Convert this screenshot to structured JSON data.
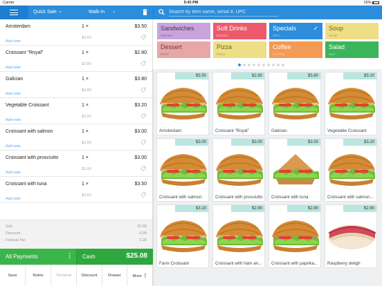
{
  "status_bar": {
    "carrier": "Carrier",
    "time": "5:43 PM",
    "battery": "15%"
  },
  "header": {
    "order_type": "Quick Sale",
    "customer": "Walk-In"
  },
  "search": {
    "placeholder": "Search by item name, serial #, UPC"
  },
  "order_items": [
    {
      "name": "Amsterdam",
      "qty": "1 ×",
      "price": "$3.50",
      "unit": "$3.50",
      "note": "Add note"
    },
    {
      "name": "Croissant \"Royal\"",
      "qty": "1 ×",
      "price": "$2.80",
      "unit": "$2.80",
      "note": "Add note"
    },
    {
      "name": "Galician",
      "qty": "1 ×",
      "price": "$3.80",
      "unit": "$3.80",
      "note": "Add note"
    },
    {
      "name": "Vegetable Croissant",
      "qty": "1 ×",
      "price": "$3.20",
      "unit": "$3.20",
      "note": "Add note"
    },
    {
      "name": "Croissant with salmon",
      "qty": "1 ×",
      "price": "$3.00",
      "unit": "$3.00",
      "note": "Add note"
    },
    {
      "name": "Croissant with prosciutto",
      "qty": "1 ×",
      "price": "$3.00",
      "unit": "$3.00",
      "note": "Add note"
    },
    {
      "name": "Croissant with tuna",
      "qty": "1 ×",
      "price": "$3.50",
      "unit": "$3.50",
      "note": "Add note"
    }
  ],
  "totals": {
    "sub_label": "Sub",
    "sub_value": "22.80",
    "discount_label": "Discount",
    "discount_value": "0.00",
    "tax_label": "Federal Tax",
    "tax_value": "2.28"
  },
  "payment": {
    "all_label": "All Payments",
    "cash_label": "Cash",
    "cash_amount": "$25.08"
  },
  "tabs": [
    "Save",
    "Notes",
    "Terminal",
    "Discount",
    "Drawer",
    "More"
  ],
  "categories": [
    {
      "name": "Sandwiches",
      "sub": "SNDWS",
      "bg": "#c9a4dc",
      "fg": "#4a3657"
    },
    {
      "name": "Soft Drinks",
      "sub": "DRINKS",
      "bg": "#ec5b6c",
      "fg": "#ffffff"
    },
    {
      "name": "Specials",
      "sub": "SPCL",
      "bg": "#2b8ddb",
      "fg": "#ffffff",
      "selected": true
    },
    {
      "name": "Soup",
      "sub": "SOUP",
      "bg": "#eedf86",
      "fg": "#6b6232"
    },
    {
      "name": "Dessert",
      "sub": "DSRT",
      "bg": "#e8a7a7",
      "fg": "#6b3c3c"
    },
    {
      "name": "Pizza",
      "sub": "PIZZA",
      "bg": "#eedf86",
      "fg": "#6b6232"
    },
    {
      "name": "Coffee",
      "sub": "COFFEE",
      "bg": "#f39a55",
      "fg": "#ffffff"
    },
    {
      "name": "Salad",
      "sub": "SLD",
      "bg": "#3cb55a",
      "fg": "#ffffff"
    }
  ],
  "pagination": {
    "pages": 10,
    "current": 1
  },
  "products": [
    {
      "name": "Amsterdam",
      "price": "$3.50",
      "type": "croissant"
    },
    {
      "name": "Croissant \"Royal\"",
      "price": "$2.80",
      "type": "croissant"
    },
    {
      "name": "Galician",
      "price": "$3.80",
      "type": "croissant"
    },
    {
      "name": "Vegetable Croissant",
      "price": "$3.20",
      "type": "croissant"
    },
    {
      "name": "Croissant with salmon",
      "price": "$3.00",
      "type": "croissant"
    },
    {
      "name": "Croissant with prosciutto",
      "price": "$3.00",
      "type": "croissant"
    },
    {
      "name": "Croissant with tuna",
      "price": "$3.50",
      "type": "sandwich"
    },
    {
      "name": "Croissant with salmon...",
      "price": "$3.20",
      "type": "croissant"
    },
    {
      "name": "Farm Croissant",
      "price": "$3.10",
      "type": "croissant"
    },
    {
      "name": "Croissant with ham an...",
      "price": "$2.90",
      "type": "croissant"
    },
    {
      "name": "Croissant with paprika...",
      "price": "$2.80",
      "type": "croissant"
    },
    {
      "name": "Raspberry deligh",
      "price": "$2.80",
      "type": "roll"
    }
  ],
  "colors": {
    "primary": "#2b8ddb",
    "green": "#3ab54a",
    "badge": "#b9e7df"
  }
}
